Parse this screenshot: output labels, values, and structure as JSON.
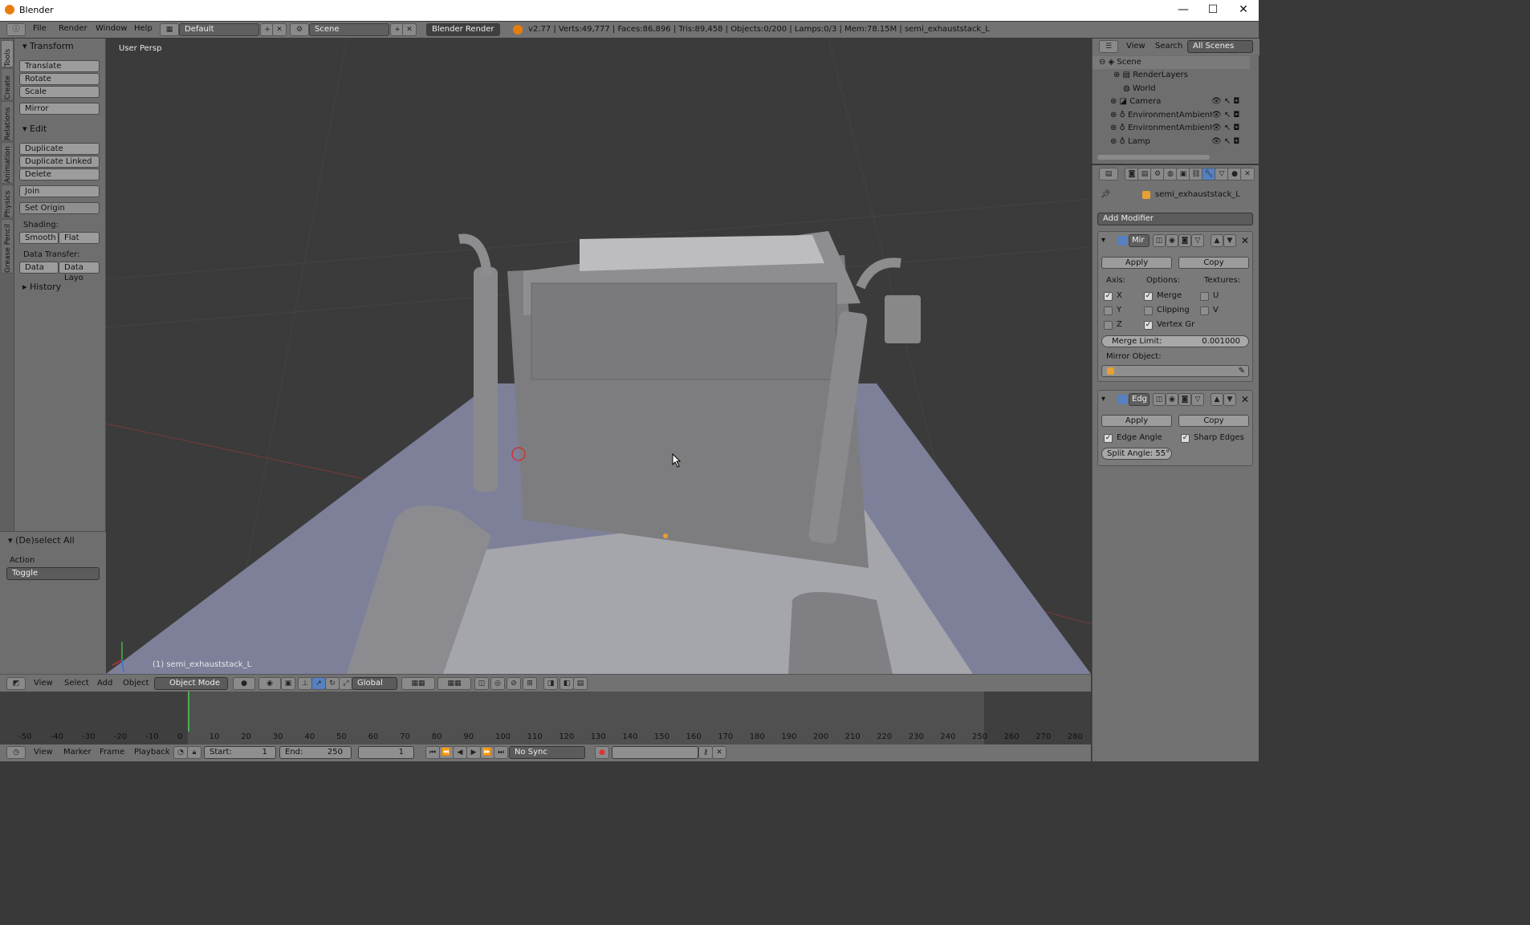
{
  "window": {
    "title": "Blender",
    "minimize": "—",
    "maximize": "☐",
    "close": "✕"
  },
  "infobar": {
    "menus": [
      "File",
      "Render",
      "Window",
      "Help"
    ],
    "layout": "Default",
    "scene": "Scene",
    "engine": "Blender Render",
    "stats": "v2.77 | Verts:49,777 | Faces:86,896 | Tris:89,458 | Objects:0/200 | Lamps:0/3 | Mem:78.15M | semi_exhauststack_L"
  },
  "tool_tabs": [
    "Tools",
    "Create",
    "Relations",
    "Animation",
    "Physics",
    "Grease Pencil"
  ],
  "toolshelf": {
    "transform": {
      "title": "Transform",
      "buttons": [
        "Translate",
        "Rotate",
        "Scale",
        "Mirror"
      ]
    },
    "edit": {
      "title": "Edit",
      "buttons": [
        "Duplicate",
        "Duplicate Linked",
        "Delete",
        "Join"
      ],
      "set_origin": "Set Origin"
    },
    "shading": {
      "label": "Shading:",
      "smooth": "Smooth",
      "flat": "Flat"
    },
    "data_transfer": {
      "label": "Data Transfer:",
      "data": "Data",
      "data_layout": "Data Layo"
    },
    "history": "History"
  },
  "operator": {
    "title": "(De)select All",
    "action_label": "Action",
    "action_value": "Toggle"
  },
  "viewport": {
    "view_name": "User Persp",
    "object_name": "(1) semi_exhauststack_L"
  },
  "header3d": {
    "menus": [
      "View",
      "Select",
      "Add",
      "Object"
    ],
    "mode": "Object Mode",
    "orientation": "Global"
  },
  "timeline": {
    "ticks": [
      "-50",
      "-40",
      "-30",
      "-20",
      "-10",
      "0",
      "10",
      "20",
      "30",
      "40",
      "50",
      "60",
      "70",
      "80",
      "90",
      "100",
      "110",
      "120",
      "130",
      "140",
      "150",
      "160",
      "170",
      "180",
      "190",
      "200",
      "210",
      "220",
      "230",
      "240",
      "250",
      "260",
      "270",
      "280"
    ],
    "menus": [
      "View",
      "Marker",
      "Frame",
      "Playback"
    ],
    "start_label": "Start:",
    "start": "1",
    "end_label": "End:",
    "end": "250",
    "current": "1",
    "sync": "No Sync"
  },
  "outliner": {
    "menus": [
      "View",
      "Search"
    ],
    "filter": "All Scenes",
    "items": [
      "Scene",
      "RenderLayers",
      "World",
      "Camera",
      "EnvironmentAmbientLi",
      "EnvironmentAmbientLi",
      "Lamp"
    ]
  },
  "properties": {
    "object": "semi_exhauststack_L",
    "add_modifier": "Add Modifier",
    "mirror": {
      "name": "Mir",
      "apply": "Apply",
      "copy": "Copy",
      "axis_label": "Axis:",
      "options_label": "Options:",
      "textures_label": "Textures:",
      "axes": [
        {
          "label": "X",
          "checked": true
        },
        {
          "label": "Y",
          "checked": false
        },
        {
          "label": "Z",
          "checked": false
        }
      ],
      "options": [
        {
          "label": "Merge",
          "checked": true
        },
        {
          "label": "Clipping",
          "checked": false
        },
        {
          "label": "Vertex Gr",
          "checked": true
        }
      ],
      "textures": [
        {
          "label": "U",
          "checked": false
        },
        {
          "label": "V",
          "checked": false
        }
      ],
      "merge_limit_label": "Merge Limit:",
      "merge_limit": "0.001000",
      "mirror_object_label": "Mirror Object:"
    },
    "edgesplit": {
      "name": "Edg",
      "apply": "Apply",
      "copy": "Copy",
      "edge_angle": "Edge Angle",
      "sharp_edges": "Sharp Edges",
      "split_angle": "Split Angle: 55°"
    }
  }
}
